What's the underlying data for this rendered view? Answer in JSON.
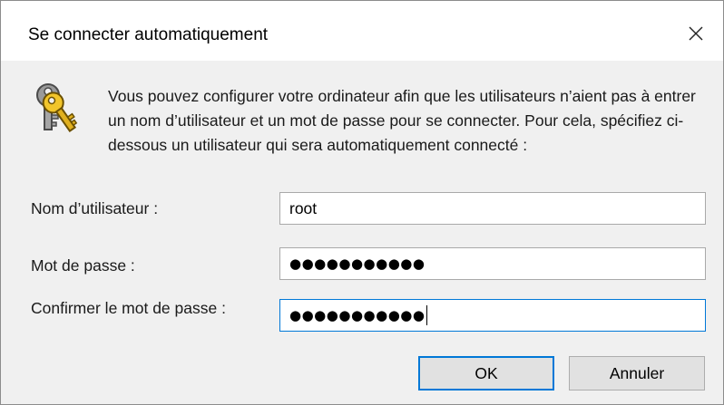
{
  "window": {
    "title": "Se connecter automatiquement",
    "close_glyph": "✕"
  },
  "message": "Vous pouvez configurer votre ordinateur afin que les utilisateurs n’aient pas à entrer un nom d’utilisateur et un mot de passe pour se connecter. Pour cela, spécifiez ci-dessous un utilisateur qui sera automatiquement connecté :",
  "icon": "keys-icon",
  "form": {
    "username_label": "Nom d’utilisateur :",
    "username_value": "root",
    "password_label": "Mot de passe :",
    "password_value": "●●●●●●●●●●●",
    "confirm_label": "Confirmer le mot de passe :",
    "confirm_value": "●●●●●●●●●●●"
  },
  "buttons": {
    "ok_label": "OK",
    "cancel_label": "Annuler"
  },
  "colors": {
    "accent": "#0078d7",
    "dialog_bg": "#f0f0f0",
    "titlebar_bg": "#ffffff"
  }
}
